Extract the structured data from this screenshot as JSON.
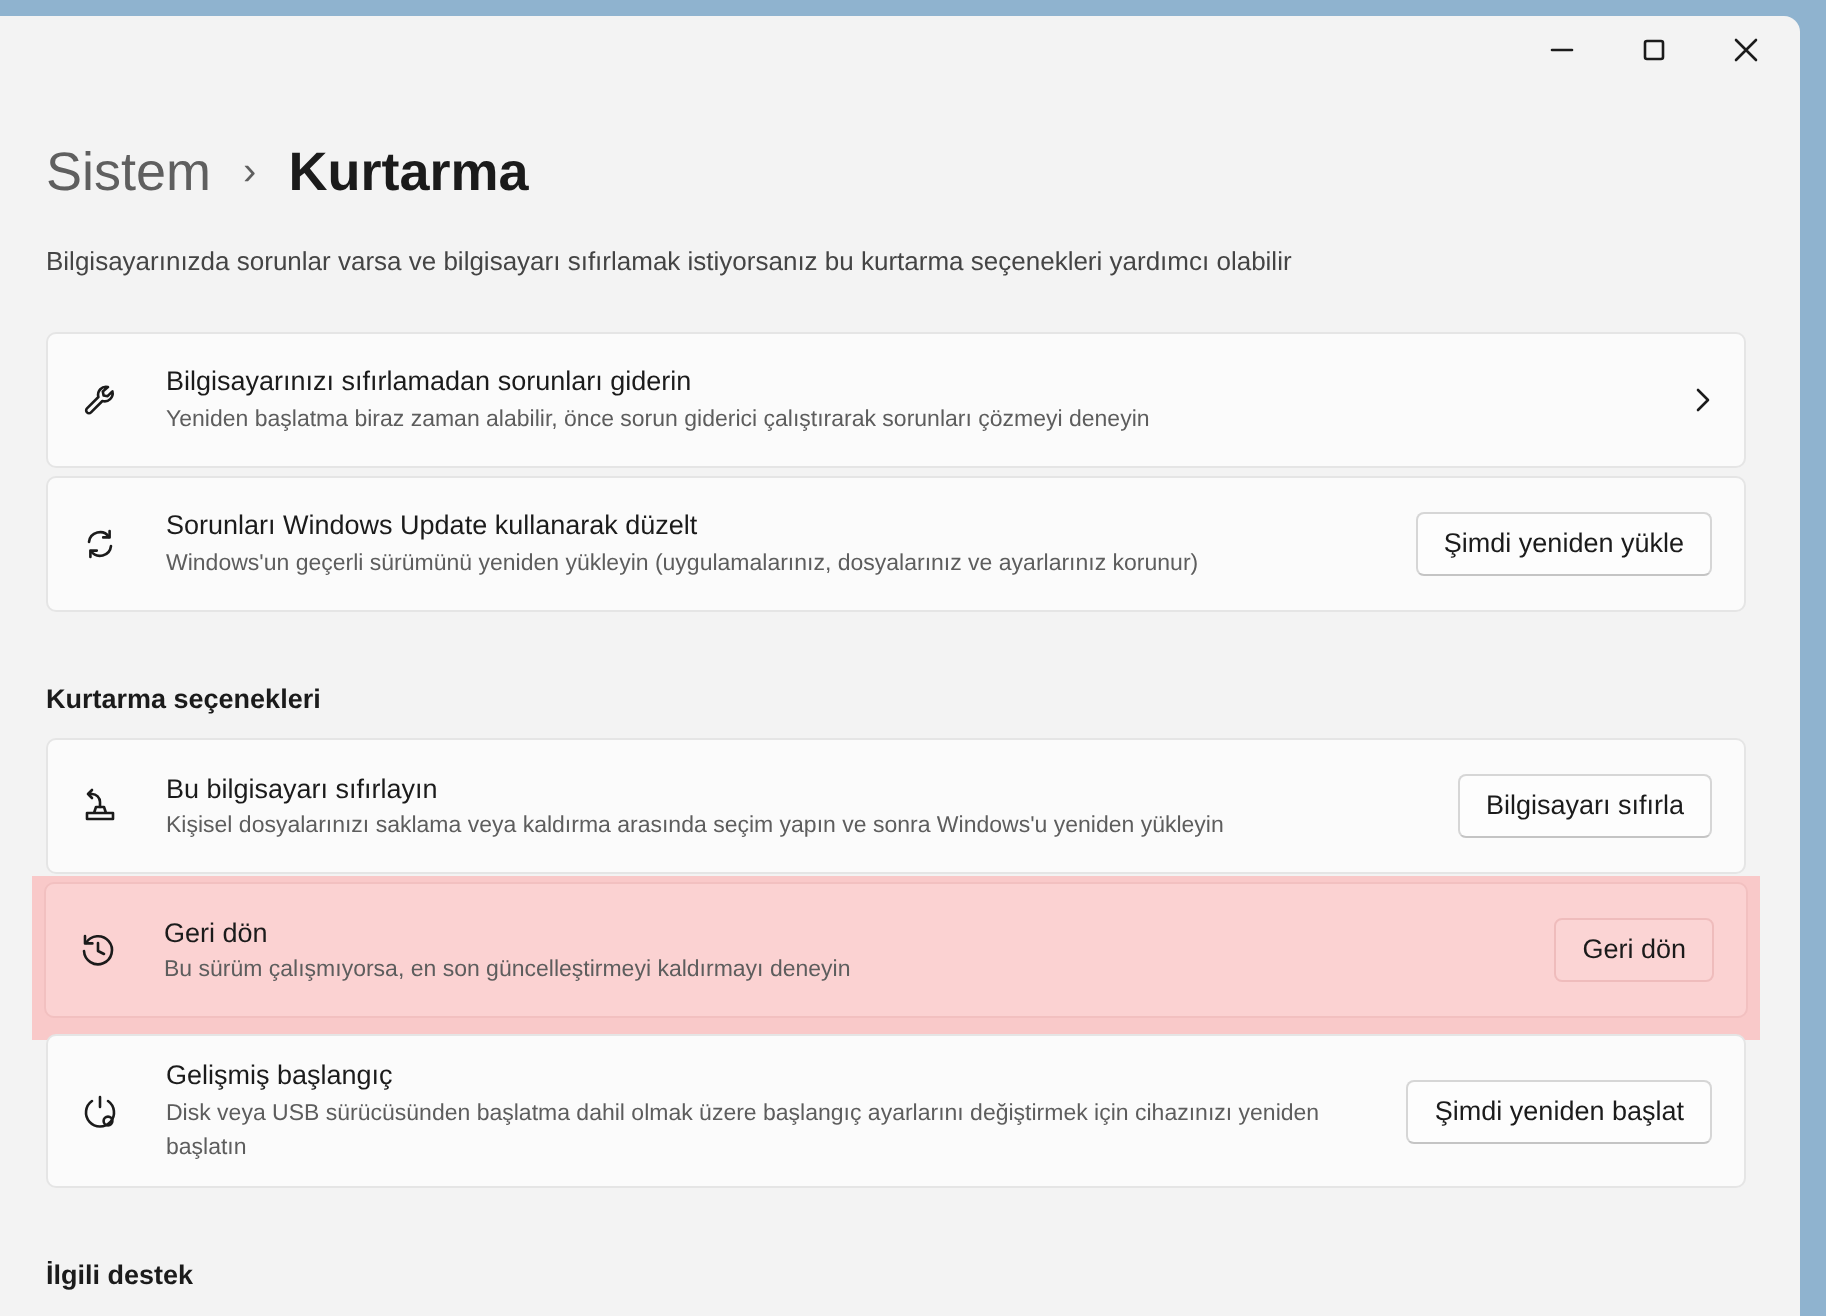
{
  "breadcrumb": {
    "parent": "Sistem",
    "separator": "›",
    "current": "Kurtarma"
  },
  "description": "Bilgisayarınızda sorunlar varsa ve bilgisayarı sıfırlamak istiyorsanız bu kurtarma seçenekleri yardımcı olabilir",
  "sections": [
    {
      "items": [
        {
          "kind": "chevron",
          "title": "Bilgisayarınızı sıfırlamadan sorunları giderin",
          "subtitle": "Yeniden başlatma biraz zaman alabilir, önce sorun giderici çalıştırarak sorunları çözmeyi deneyin",
          "highlighted": false
        },
        {
          "kind": "button",
          "title": "Sorunları Windows Update kullanarak düzelt",
          "subtitle": "Windows'un geçerli sürümünü yeniden yükleyin (uygulamalarınız, dosyalarınız ve ayarlarınız korunur)",
          "button": "Şimdi yeniden yükle",
          "highlighted": false
        }
      ]
    },
    {
      "heading": "Kurtarma seçenekleri",
      "items": [
        {
          "kind": "button",
          "title": "Bu bilgisayarı sıfırlayın",
          "subtitle": "Kişisel dosyalarınızı saklama veya kaldırma arasında seçim yapın ve sonra Windows'u yeniden yükleyin",
          "button": "Bilgisayarı sıfırla",
          "highlighted": false
        },
        {
          "kind": "button",
          "title": "Geri dön",
          "subtitle": "Bu sürüm çalışmıyorsa, en son güncelleştirmeyi kaldırmayı deneyin",
          "button": "Geri dön",
          "highlighted": true
        },
        {
          "kind": "button",
          "title": "Gelişmiş başlangıç",
          "subtitle": "Disk veya USB sürücüsünden başlatma dahil olmak üzere başlangıç ayarlarını değiştirmek için cihazınızı yeniden başlatın",
          "button": "Şimdi yeniden başlat",
          "highlighted": false
        }
      ]
    },
    {
      "heading": "İlgili destek"
    }
  ]
}
